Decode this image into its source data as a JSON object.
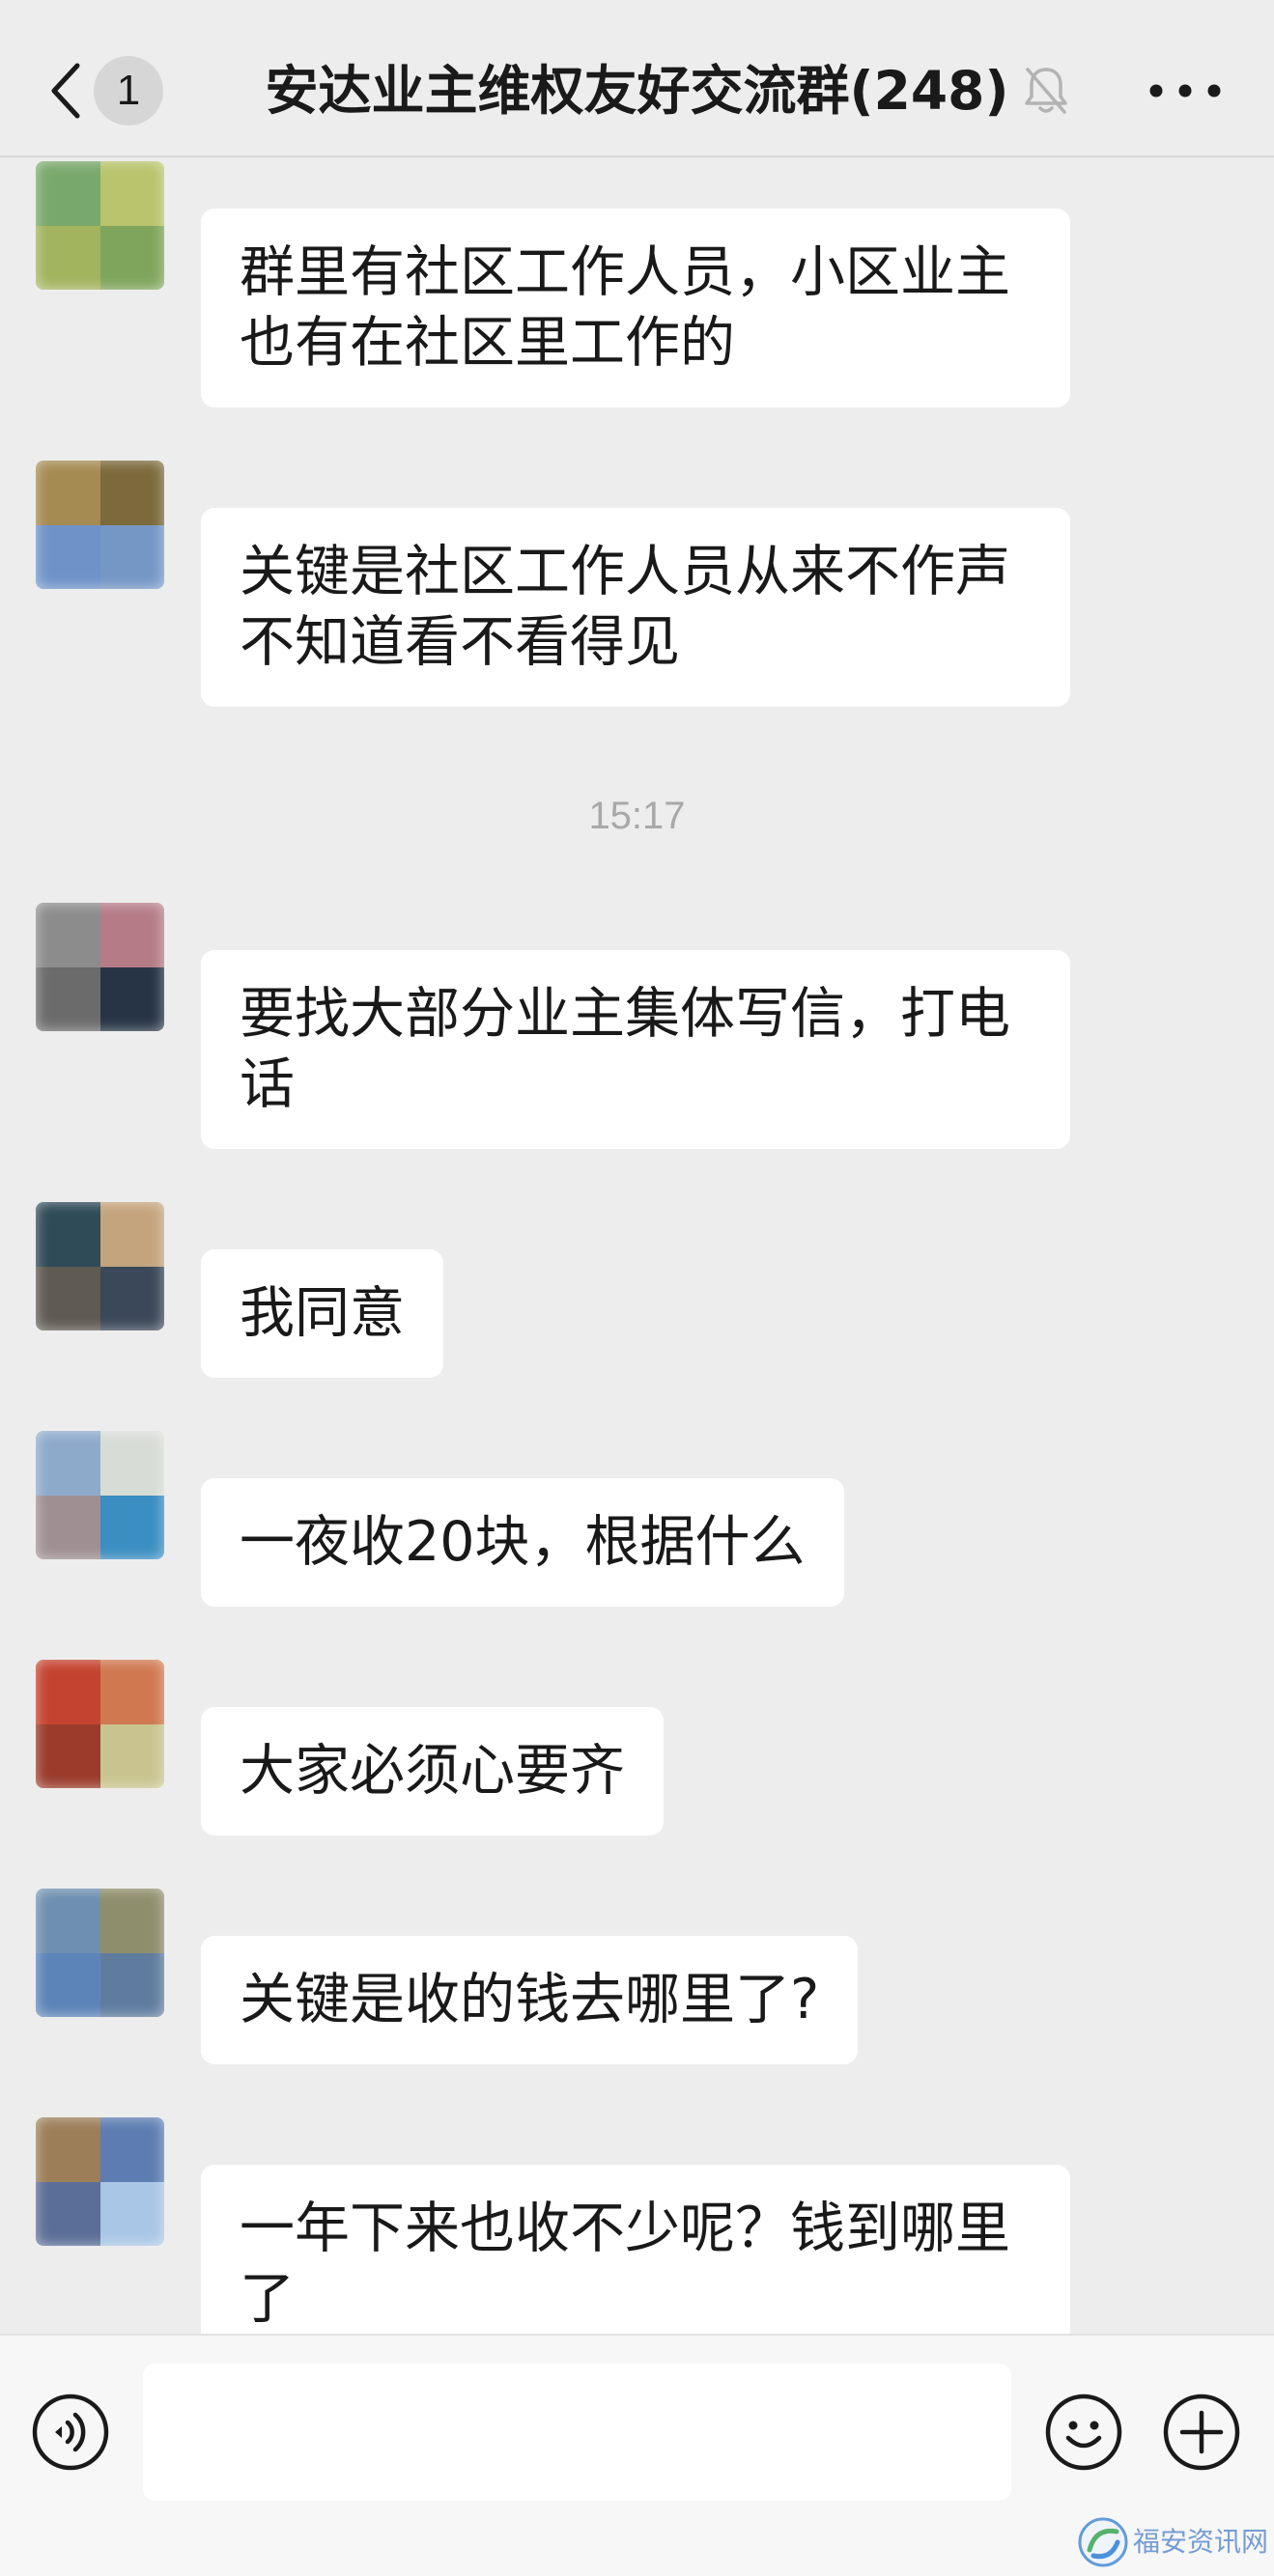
{
  "header": {
    "back_icon": "chevron-left-icon",
    "unread_badge": "1",
    "title": "安达业主维权友好交流群(248)",
    "mute_icon": "bell-slash-icon",
    "more_icon": "more-dots-icon"
  },
  "chat": {
    "messages": [
      {
        "avatar_colors": [
          "#79a86c",
          "#b9c46d",
          "#a2b45e",
          "#7fa55c"
        ],
        "text": "群里有社区工作人员，小区业主也有在社区里工作的"
      },
      {
        "avatar_colors": [
          "#a58a52",
          "#7c6a3c",
          "#6f93c9",
          "#7597c6"
        ],
        "text": "关键是社区工作人员从来不作声不知道看不看得见"
      },
      {
        "avatar_colors": [
          "#8c8c8c",
          "#b57c88",
          "#6b6b6b",
          "#263446"
        ],
        "text": "要找大部分业主集体写信，打电话"
      },
      {
        "avatar_colors": [
          "#2f4b57",
          "#c4a47c",
          "#5f5a52",
          "#3b4859"
        ],
        "text": "我同意"
      },
      {
        "avatar_colors": [
          "#8eaacb",
          "#d8dcd6",
          "#9f8f93",
          "#3a8ec2"
        ],
        "text": "一夜收20块，根据什么"
      },
      {
        "avatar_colors": [
          "#c4432f",
          "#d07850",
          "#9a3b2c",
          "#c9c48f"
        ],
        "text": "大家必须心要齐"
      },
      {
        "avatar_colors": [
          "#6e8fb0",
          "#8f8e6c",
          "#5c84b8",
          "#5f7c9f"
        ],
        "text": "关键是收的钱去哪里了?"
      },
      {
        "avatar_colors": [
          "#9c7e58",
          "#5d7db2",
          "#5b6e97",
          "#a9c6e6"
        ],
        "text": "一年下来也收不少呢？钱到哪里了"
      }
    ],
    "time_divider": "15:17"
  },
  "input_bar": {
    "value": "",
    "voice_icon": "voice-icon",
    "emoji_icon": "emoji-icon",
    "plus_icon": "plus-icon"
  },
  "colors": {
    "page_background": "#ededed",
    "bubble_background": "#ffffff",
    "message_text": "#191919",
    "timestamp_text": "#a8a8a8",
    "input_bar_background": "#f7f7f7",
    "mute_icon": "#b3b3b3"
  },
  "watermark": {
    "text": "福安资讯网"
  }
}
